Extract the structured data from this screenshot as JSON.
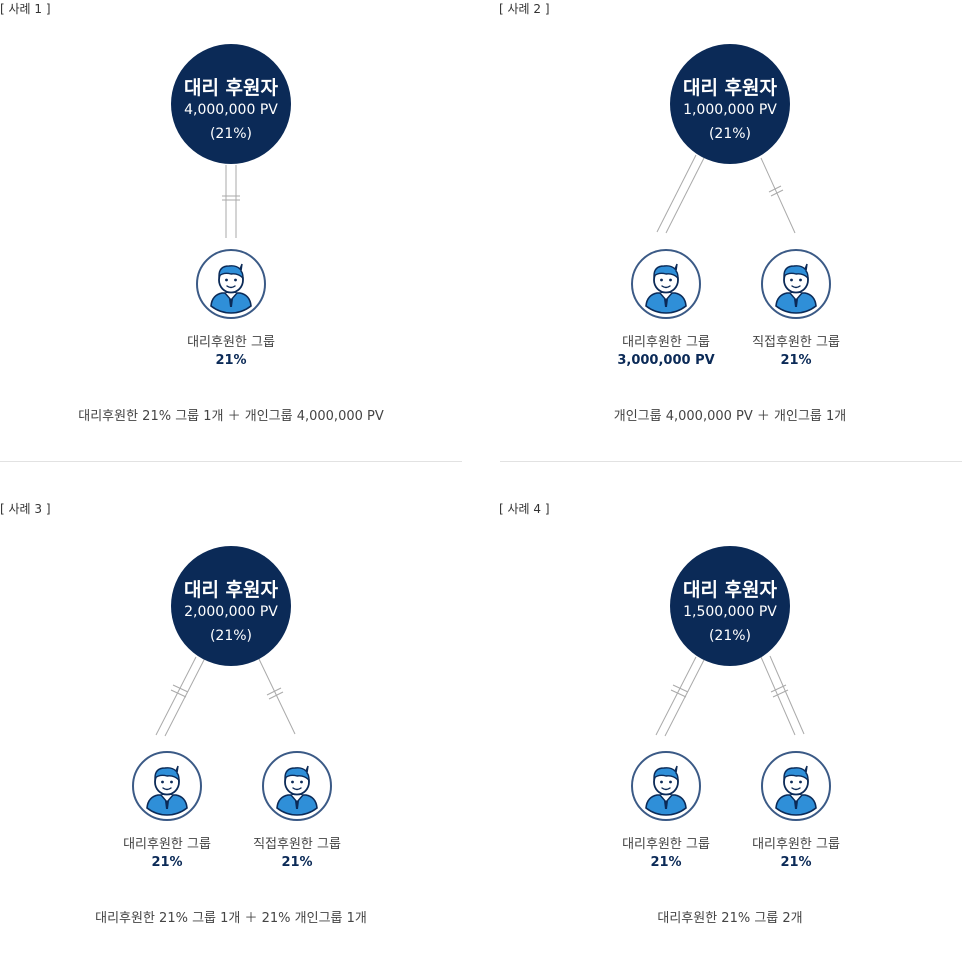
{
  "cases": [
    {
      "label": "[ 사례 1 ]",
      "root": {
        "title": "대리 후원자",
        "pv": "4,000,000 PV",
        "pct": "(21%)"
      },
      "children": [
        {
          "label": "대리후원한 그룹",
          "value": "21%",
          "link": "sponsored"
        }
      ],
      "summary": "대리후원한 21% 그룹 1개 ＋ 개인그룹 4,000,000 PV"
    },
    {
      "label": "[ 사례 2 ]",
      "root": {
        "title": "대리 후원자",
        "pv": "1,000,000 PV",
        "pct": "(21%)"
      },
      "children": [
        {
          "label": "대리후원한 그룹",
          "value": "3,000,000 PV",
          "link": "double"
        },
        {
          "label": "직접후원한 그룹",
          "value": "21%",
          "link": "direct"
        }
      ],
      "summary": "개인그룹 4,000,000 PV ＋ 개인그룹 1개"
    },
    {
      "label": "[ 사례 3 ]",
      "root": {
        "title": "대리 후원자",
        "pv": "2,000,000 PV",
        "pct": "(21%)"
      },
      "children": [
        {
          "label": "대리후원한 그룹",
          "value": "21%",
          "link": "sponsored"
        },
        {
          "label": "직접후원한 그룹",
          "value": "21%",
          "link": "direct"
        }
      ],
      "summary": "대리후원한 21% 그룹 1개 ＋ 21% 개인그룹 1개"
    },
    {
      "label": "[ 사례 4 ]",
      "root": {
        "title": "대리 후원자",
        "pv": "1,500,000 PV",
        "pct": "(21%)"
      },
      "children": [
        {
          "label": "대리후원한 그룹",
          "value": "21%",
          "link": "sponsored"
        },
        {
          "label": "대리후원한 그룹",
          "value": "21%",
          "link": "sponsored"
        }
      ],
      "summary": "대리후원한 21% 그룹 2개"
    }
  ],
  "colors": {
    "navy": "#0b2a57",
    "avatar_blue": "#2f8fd8",
    "line": "#aaaaaa"
  },
  "icons": [
    "person-avatar-icon"
  ]
}
